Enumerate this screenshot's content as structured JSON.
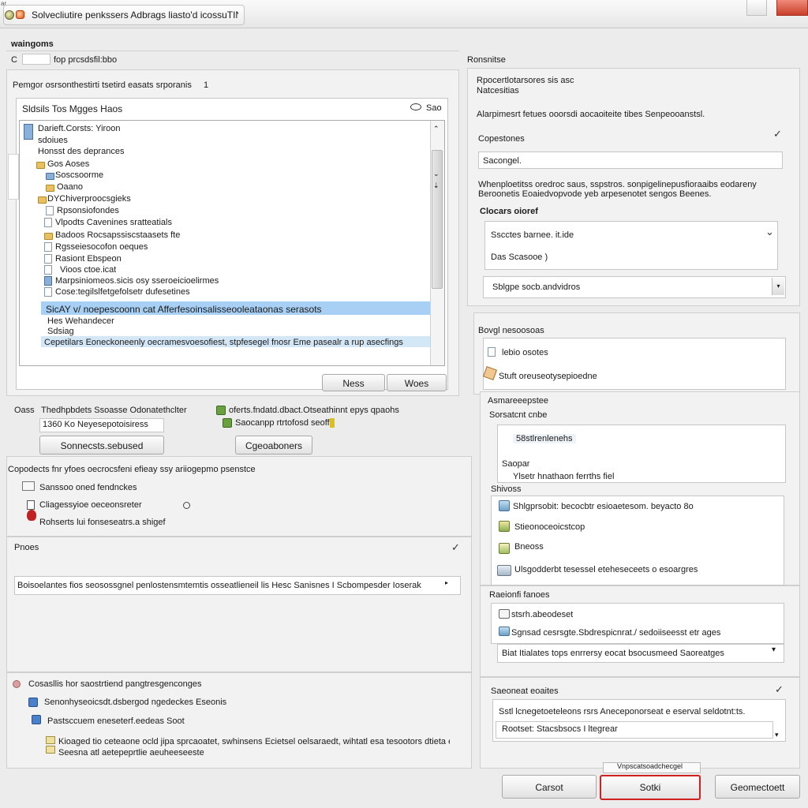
{
  "window": {
    "title": "Solvecliutire penkssers Adbrags liasto'd icossuTINg",
    "corner_label": "ar"
  },
  "left": {
    "section_title": "waingoms",
    "top_option": {
      "prefix": "C",
      "label": "fop prcsdsfil:bbo"
    },
    "group_label": "Pemgor osrsonthestirti tsetird easats srporanis",
    "group_marker": "1",
    "tree": {
      "header": "Sldsils Tos Mgges Haos",
      "sort_label": "Sao",
      "rows": [
        "Darieft.Corsts: Yiroon",
        "sdoiues",
        "Honsst des deprances",
        "Gos Aoses",
        "Soscsoorme",
        "Oaano",
        "DYChiverproocsgieks",
        "Rpsonsiofondes",
        "Vlpodts Cavenines sratteatials",
        "Badoos Rocsapssiscstaasets fte",
        "Rgsseiesocofon oeques",
        "Rasiont Ebspeon",
        "Vioos ctoe.icat",
        "Marpsiniomeos.sicis osy sseroeicioelirmes",
        "Cose:tegilslfetgefolsetr dufesetines",
        "SicAY v/ noepescoonn cat Afferfesoinsalisseooleataonas serasots",
        "Hes Wehandecer",
        "Sdsiag",
        "Cepetilars Eoneckoneenly oecramesvoesofiest, stpfesegel fnosr Eme pasealr a rup asecfings"
      ],
      "btn_ok": "Ness",
      "btn_other": "Woes"
    },
    "options": {
      "left_label": "Oass",
      "left_text": "Thedhpbdets Ssoasse Odonatethclter",
      "left_sub": "1360 Ko Neyesepotoisiress",
      "right_text": "oferts.fndatd.dbact.Otseathinnt epys qpaohs",
      "right_sub": "Saocanpp rtrtofosd seoffets",
      "btn_left": "Sonnecsts.sebused",
      "btn_right": "Cgeoaboners"
    },
    "group2": {
      "title": "Copodects fnr yfoes oecrocsfeni efieay ssy ariiogepmo psenstce",
      "items": [
        "Sanssoo oned fendnckes",
        "Cliagessyioe oeceonsreter",
        "Rohserts lui fonseseatrs.a shigef"
      ]
    },
    "proxy": {
      "title": "Pnoes",
      "input_value": "Boisoelantes fios seosossgnel penlostensmtemtis osseatlieneil lis Hesc Sanisnes I Scbompesder Ioserak"
    },
    "group3": {
      "title": "Cosasllis hor saostrtiend pangtresgenconges",
      "items": [
        "Senonhyseoicsdt.dsbergod ngedeckes Eseonis",
        "Pastsccuem eneseterf.eedeas Soot"
      ],
      "note_line1": "Kioaged tio ceteaone ocld jipa sprcaoatet, swhinsens Ecietsel oelsaraedt, wihtatl esa tesootors dtieta elisters",
      "note_line2": "Seesna atl aetepeprtlie aeuheeseeste"
    }
  },
  "right": {
    "section_title": "Ronsnitse",
    "desc": "Rpocertlotarsores sis asc Natcesitias",
    "info": "Alarpimesrt fetues ooorsdi aocaoiteite tibes Senpeooanstsl.",
    "field1": {
      "label": "Copestones",
      "value": "Sacongel."
    },
    "info2": "Whenploetitss oredroc saus, sspstros. sonpigelinepusfioraaibs eodareny Beroonetis Eoaiedvopvode yeb arpesenotet sengos Beenes.",
    "field2": {
      "label": "Clocars oioref",
      "line1": "Sscctes barnee. it.ide",
      "line2": "Das Scasooe )"
    },
    "combo": "Sblgpe socb.andvidros",
    "list1": {
      "title": "Bovgl nesoosoas",
      "items": [
        "lebio osotes",
        "Stuft oreuseotysepioedne"
      ]
    },
    "list2": {
      "title": "Asmareeepstee",
      "subtitle": "Sorsatcnt cnbe",
      "items": [
        "58stlrenlenehs",
        "Saopar",
        "Ylsetr hnathaon ferrths fiel"
      ],
      "title2": "Shivoss",
      "items2": [
        "Shlgprsobit: becocbtr esioaetesom. beyacto 8o",
        "Stieonoceoicstcop",
        "Bneoss",
        "Ulsgodderbt tesessel eteheseceets o esoargres"
      ]
    },
    "list3": {
      "title": "Raeionfi fanoes",
      "items": [
        "stsrh.abeodeset",
        "Sgnsad cesrsgte.Sbdrespicnrat./ sedoiiseesst etr ages"
      ],
      "combo": "Biat Itialates tops enrrersy eocat bsocusmeed Saoreatges"
    },
    "list4": {
      "title": "Saeoneat eoaites",
      "line1": "Sstl lcnegetoeteleons rsrs Aneceponorseat e eserval seldotnt:ts.",
      "line2": "Rootset: Stacsbsocs I ltegrear"
    }
  },
  "footer": {
    "tooltip": "Vnpscatsoadchecgel",
    "cancel": "Carsot",
    "ok": "Sotki",
    "apply": "Geomectoett"
  }
}
